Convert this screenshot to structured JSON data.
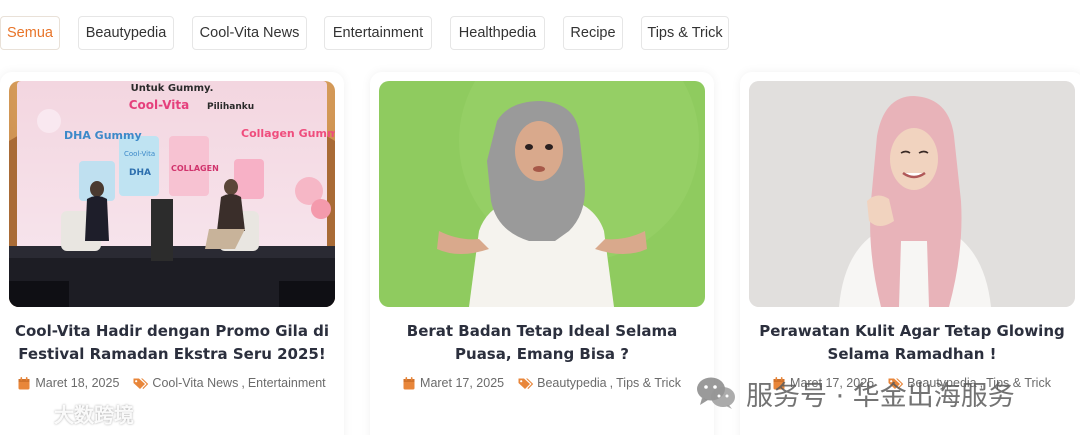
{
  "tabs": [
    {
      "label": "Semua",
      "active": true
    },
    {
      "label": "Beautypedia",
      "active": false
    },
    {
      "label": "Cool-Vita News",
      "active": false
    },
    {
      "label": "Entertainment",
      "active": false
    },
    {
      "label": "Healthpedia",
      "active": false
    },
    {
      "label": "Recipe",
      "active": false
    },
    {
      "label": "Tips & Trick",
      "active": false
    }
  ],
  "posts": [
    {
      "title": "Cool-Vita Hadir dengan Promo Gila di Festival Ramadan Ekstra Seru 2025!",
      "date": "Maret 18, 2025",
      "categories": [
        "Cool-Vita News",
        "Entertainment"
      ],
      "image_text": {
        "line1": "Untuk Gummy.",
        "brand": "Cool-Vita",
        "brand_suffix": "Pilihanku",
        "left_product": "DHA Gummy",
        "right_product": "Collagen Gummy",
        "pack_label_1": "Cool-Vita",
        "pack_label_2": "DHA",
        "pack_label_3": "COLLAGEN"
      }
    },
    {
      "title": "Berat Badan Tetap Ideal Selama Puasa, Emang Bisa ?",
      "date": "Maret 17, 2025",
      "categories": [
        "Beautypedia",
        "Tips & Trick"
      ]
    },
    {
      "title": "Perawatan Kulit Agar Tetap Glowing Selama Ramadhan !",
      "date": "Maret 17, 2025",
      "categories": [
        "Beautypedia",
        "Tips & Trick"
      ]
    }
  ],
  "watermarks": {
    "left": "大数跨境",
    "right": "服务号 · 华金出海服务"
  },
  "colors": {
    "accent": "#e8752a",
    "title": "#2b2f3d",
    "meta": "#6b6b6b",
    "icon": "#e8863a"
  },
  "icons": {
    "date": "calendar-icon",
    "category": "tag-icon",
    "watermark_left": "weibo-like-logo-icon",
    "watermark_right": "wechat-logo-icon"
  }
}
